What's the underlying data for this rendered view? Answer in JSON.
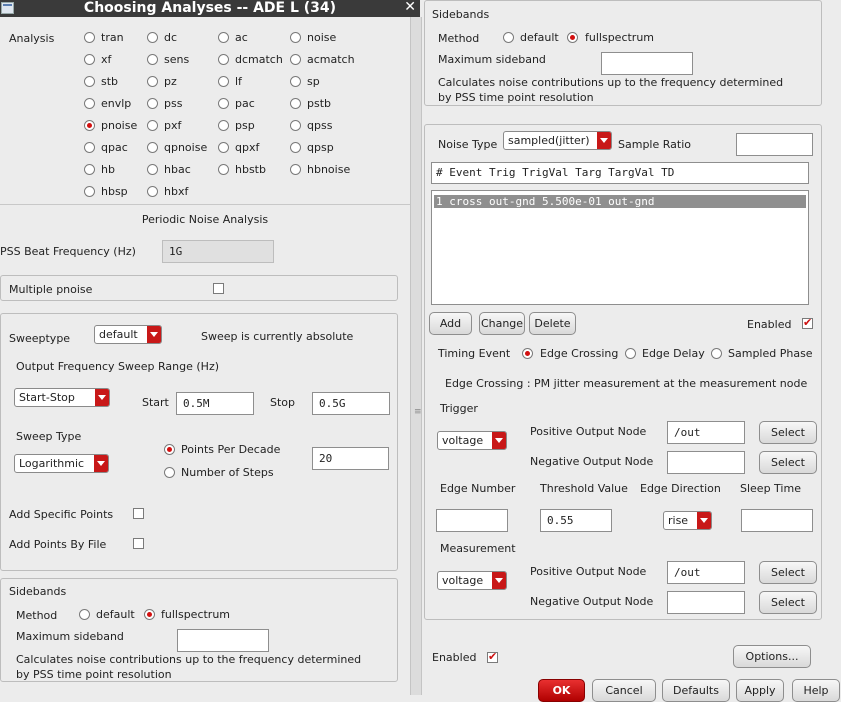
{
  "window": {
    "title": "Choosing Analyses -- ADE L (34)",
    "close_glyph": "✕"
  },
  "analysis": {
    "label": "Analysis",
    "options": [
      "tran",
      "dc",
      "ac",
      "noise",
      "xf",
      "sens",
      "dcmatch",
      "acmatch",
      "stb",
      "pz",
      "lf",
      "sp",
      "envlp",
      "pss",
      "pac",
      "pstb",
      "pnoise",
      "pxf",
      "psp",
      "qpss",
      "qpac",
      "qpnoise",
      "qpxf",
      "qpsp",
      "hb",
      "hbac",
      "hbstb",
      "hbnoise",
      "hbsp",
      "hbxf"
    ],
    "selected": "pnoise"
  },
  "pnoise": {
    "heading": "Periodic Noise Analysis",
    "beat_freq_label": "PSS Beat Frequency (Hz)",
    "beat_freq_value": "1G",
    "multiple_label": "Multiple pnoise",
    "sweeptype_label": "Sweeptype",
    "sweeptype_value": "default",
    "sweep_status": "Sweep is currently absolute",
    "range_label": "Output Frequency Sweep Range (Hz)",
    "range_mode": "Start-Stop",
    "start_label": "Start",
    "start_value": "0.5M",
    "stop_label": "Stop",
    "stop_value": "0.5G",
    "sweep_type_label": "Sweep Type",
    "sweep_type_value": "Logarithmic",
    "points_per_decade": "Points Per Decade",
    "number_of_steps": "Number of Steps",
    "points_value": "20",
    "add_specific": "Add Specific Points",
    "add_by_file": "Add Points By File"
  },
  "sidebands_left": {
    "title": "Sidebands",
    "method_label": "Method",
    "opt_default": "default",
    "opt_full": "fullspectrum",
    "max_label": "Maximum sideband",
    "note1": "Calculates noise contributions up to the frequency determined",
    "note2": "by PSS time point resolution"
  },
  "sidebands_right": {
    "title": "Sidebands",
    "method_label": "Method",
    "opt_default": "default",
    "opt_full": "fullspectrum",
    "max_label": "Maximum sideband",
    "note1": "Calculates noise contributions up to the frequency determined",
    "note2": "by PSS time point resolution"
  },
  "noise": {
    "type_label": "Noise Type",
    "type_value": "sampled(jitter)",
    "ratio_label": "Sample Ratio",
    "table_header": "#  Event Trig     TrigVal     Targ      TargVal     TD",
    "rows": [
      "1  cross out-gnd  5.500e-01  out-gnd"
    ],
    "add": "Add",
    "change": "Change",
    "delete": "Delete",
    "enabled": "Enabled",
    "timing_label": "Timing Event",
    "timing_opts": [
      "Edge Crossing",
      "Edge Delay",
      "Sampled Phase"
    ],
    "edge_desc": "Edge Crossing : PM jitter measurement at the measurement node",
    "trigger": "Trigger",
    "trigger_type": "voltage",
    "pos_out": "Positive Output Node",
    "neg_out": "Negative Output Node",
    "trig_pos_value": "/out",
    "select": "Select",
    "edge_number": "Edge Number",
    "threshold": "Threshold Value",
    "threshold_value": "0.55",
    "edge_direction": "Edge Direction",
    "edge_direction_value": "rise",
    "sleep_time": "Sleep Time",
    "measurement": "Measurement",
    "meas_type": "voltage",
    "meas_pos_value": "/out"
  },
  "footer": {
    "enabled": "Enabled",
    "options": "Options...",
    "ok": "OK",
    "cancel": "Cancel",
    "defaults": "Defaults",
    "apply": "Apply",
    "help": "Help"
  },
  "colors": {
    "accent_red": "#c81818",
    "titlebar": "#3a3a3a"
  }
}
